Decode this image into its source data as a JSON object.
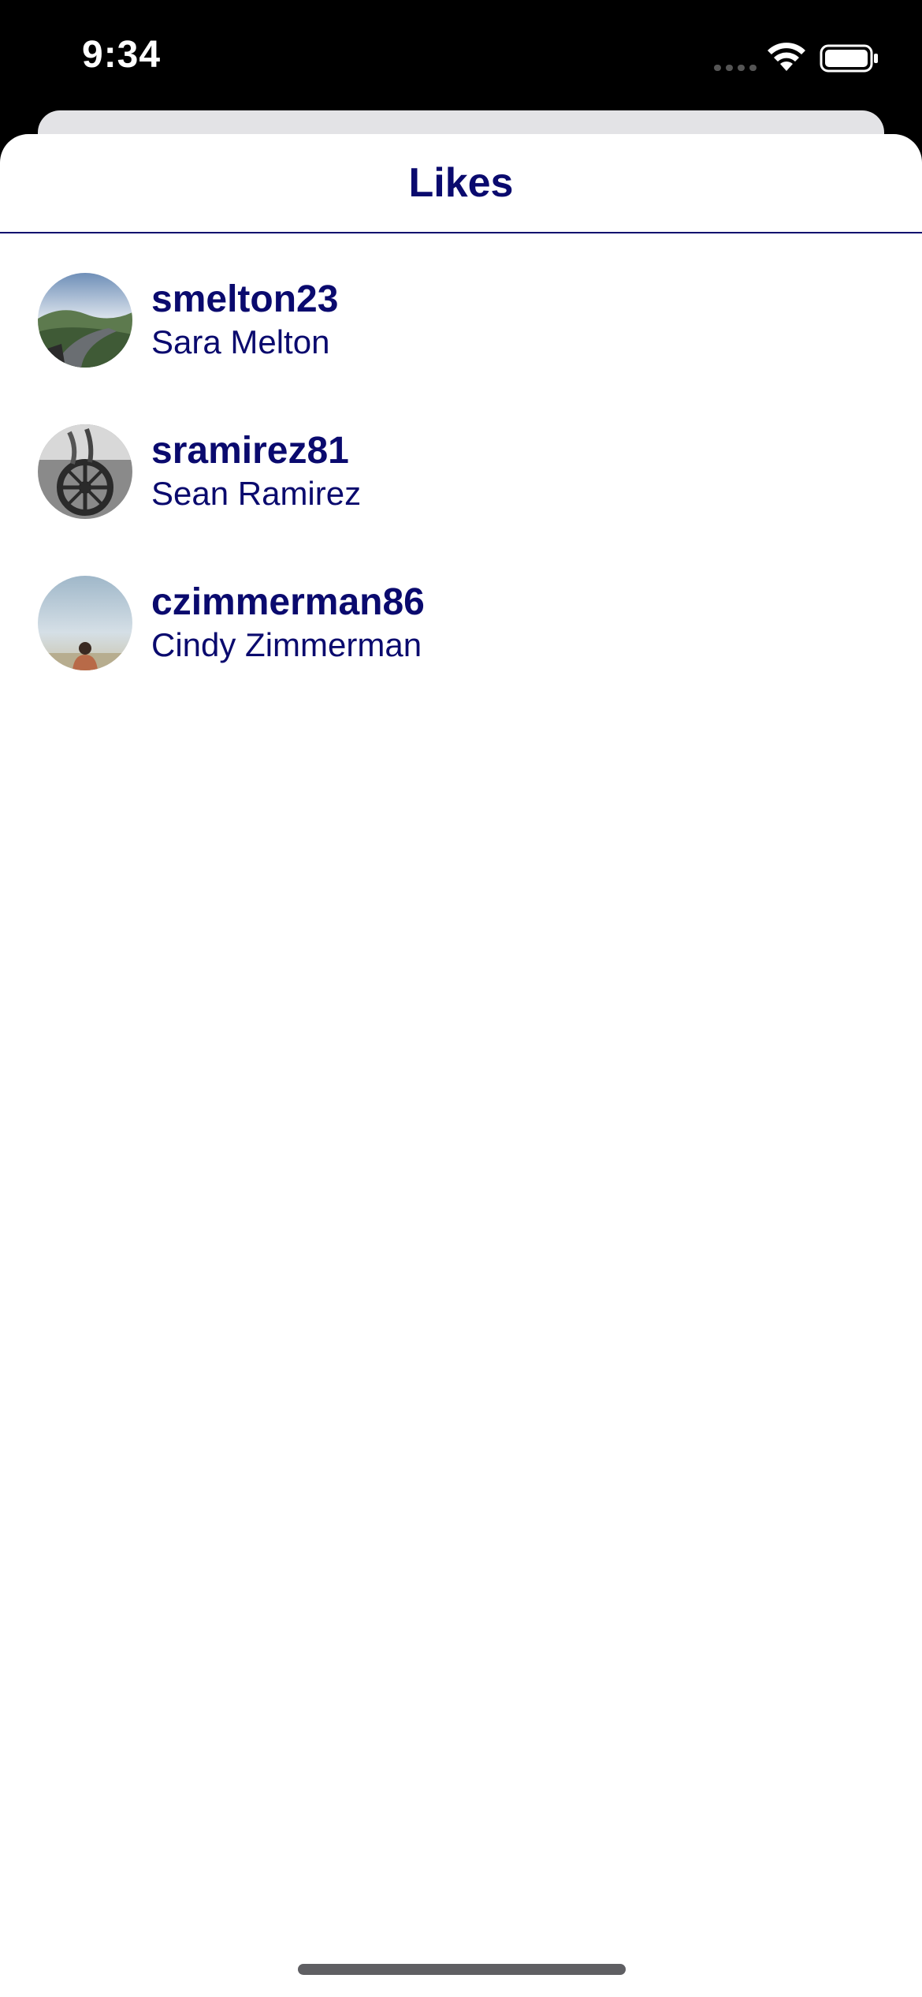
{
  "status_bar": {
    "time": "9:34",
    "icons": [
      "cellular-signal-icon",
      "wifi-icon",
      "battery-icon"
    ]
  },
  "sheet": {
    "title": "Likes"
  },
  "likes": [
    {
      "username": "smelton23",
      "name": "Sara Melton",
      "avatar": "landscape-road-photo"
    },
    {
      "username": "sramirez81",
      "name": "Sean Ramirez",
      "avatar": "bw-wheel-photo"
    },
    {
      "username": "czimmerman86",
      "name": "Cindy Zimmerman",
      "avatar": "person-sky-photo"
    }
  ],
  "colors": {
    "accent": "#0a0a6e",
    "background": "#ffffff",
    "status_bar_bg": "#000000"
  }
}
